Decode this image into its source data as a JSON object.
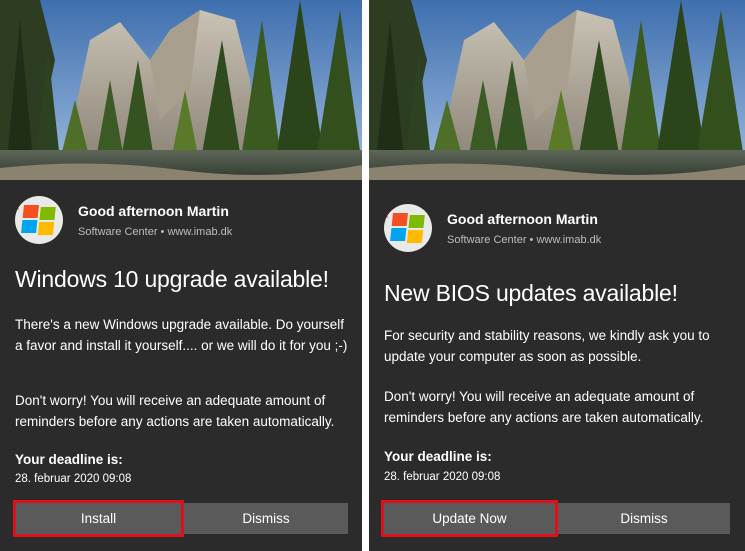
{
  "toasts": [
    {
      "greeting": "Good afternoon Martin",
      "attribution": "Software Center • www.imab.dk",
      "title": "Windows 10 upgrade available!",
      "body1": "There's a new Windows upgrade available. Do yourself a favor and install it yourself.... or we will do it for you ;-)",
      "body2": "Don't worry! You will receive an adequate amount of reminders before any actions are taken automatically.",
      "deadline_label": "Your deadline is:",
      "deadline_value": "28. februar 2020 09:08",
      "primary_button": "Install",
      "dismiss_button": "Dismiss"
    },
    {
      "greeting": "Good afternoon Martin",
      "attribution": "Software Center • www.imab.dk",
      "title": "New BIOS updates available!",
      "body1": "For security and stability reasons, we kindly ask you to update your computer as soon as possible.",
      "body2": "Don't worry! You will receive an adequate amount of reminders before any actions are taken automatically.",
      "deadline_label": "Your deadline is:",
      "deadline_value": "28. februar 2020 09:08",
      "primary_button": "Update Now",
      "dismiss_button": "Dismiss"
    }
  ],
  "icons": {
    "app_logo": "windows-flag-logo",
    "hero": "mountain-forest-landscape"
  },
  "colors": {
    "toast_background": "#2b2b2b",
    "button_background": "#5a5a5a",
    "highlight": "#e0101a"
  }
}
